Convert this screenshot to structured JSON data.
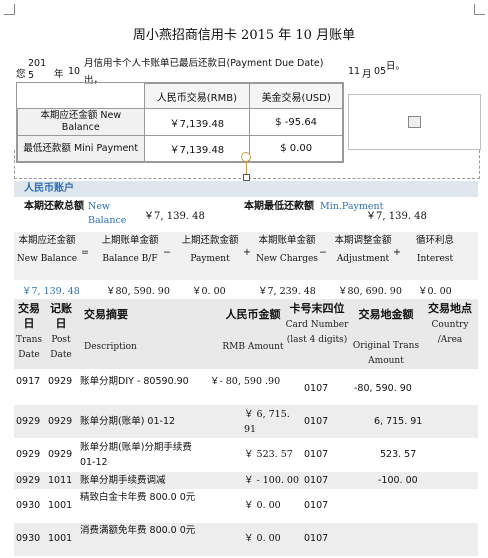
{
  "title": "周小燕招商信用卡 2015 年 10 月账单",
  "statement": {
    "p1": "您",
    "year": "201 5",
    "p2": "年",
    "month": "10",
    "p3": "月信用卡个人卡账单已最后还款日(Payment Due Date)",
    "p4": "出，",
    "due_month": "11",
    "p5": "月",
    "due_day": "05",
    "p6": "日。"
  },
  "summary_top": {
    "col_rmb": "人民币交易(RMB)",
    "col_usd": "美金交易(USD)",
    "rows": [
      {
        "label": "本期应还金额 New Balance",
        "rmb": "￥7,139.48",
        "usd": "$ -95.64"
      },
      {
        "label": "最低还款额 Mini Payment",
        "rmb": "￥7,139.48",
        "usd": "$ 0.00"
      }
    ]
  },
  "account": {
    "section_title": "人民币账户",
    "total_label": "本期还款总额",
    "total_en": "New Balance",
    "total_value": "￥7, 139. 48",
    "min_label": "本期最低还款额",
    "min_en": "Min.Payment",
    "min_value": "￥7, 139. 48"
  },
  "calc": {
    "items": [
      {
        "cn": "本期应还金额",
        "en": "New Balance"
      },
      {
        "cn": "上期账单金额",
        "en": "Balance B/F"
      },
      {
        "cn": "上期还款金额",
        "en": "Payment"
      },
      {
        "cn": "本期账单金额",
        "en": "New Charges"
      },
      {
        "cn": "本期调整金额",
        "en": "Adjustment"
      },
      {
        "cn": "循环利息",
        "en": "Interest"
      }
    ],
    "ops": [
      "=",
      "−",
      "+",
      "−",
      "+"
    ],
    "values": [
      "￥7, 139. 48",
      "￥80, 590. 90",
      "￥0. 00",
      "￥7, 239. 48",
      "￥80, 690. 90",
      "￥0. 00"
    ]
  },
  "txn_headers": [
    {
      "cn": "交易日",
      "en": "Trans Date"
    },
    {
      "cn": "记账日",
      "en": "Post Date"
    },
    {
      "cn": "交易摘要",
      "en": "Description"
    },
    {
      "cn": "人民币金额",
      "en": "RMB Amount"
    },
    {
      "cn": "卡号末四位",
      "en": "Card Number (last 4 digits)"
    },
    {
      "cn": "交易地金额",
      "en": "Original Trans Amount"
    },
    {
      "cn": "交易地点",
      "en": "Country /Area"
    }
  ],
  "transactions": [
    {
      "trans": "0917",
      "post": "0929",
      "desc": "账单分期DIY - 80590.90",
      "rmb": "￥- 80, 590 .90",
      "card": "0107",
      "orig": "-80, 590. 90"
    },
    {
      "trans": "0929",
      "post": "0929",
      "desc": "账单分期(账单) 01-12",
      "rmb": "￥ 6, 715. 91",
      "card": "0107",
      "orig": "6, 715. 91"
    },
    {
      "trans": "0929",
      "post": "0929",
      "desc": "账单分期(账单)分期手续费 01-12",
      "rmb": "￥ 523. 57",
      "card": "0107",
      "orig": "523. 57"
    },
    {
      "trans": "0929",
      "post": "1011",
      "desc": "账单分期手续费调减",
      "rmb": "￥ - 100. 00",
      "card": "0107",
      "orig": "-100. 00"
    },
    {
      "trans": "0930",
      "post": "1001",
      "desc": "精致白金卡年费 800.0 0元",
      "rmb": "￥ 0. 00",
      "card": "0107",
      "orig": ""
    },
    {
      "trans": "0930",
      "post": "1001",
      "desc": "消费满额免年费 800.0 0元",
      "rmb": "￥ 0. 00",
      "card": "0107",
      "orig": ""
    }
  ]
}
